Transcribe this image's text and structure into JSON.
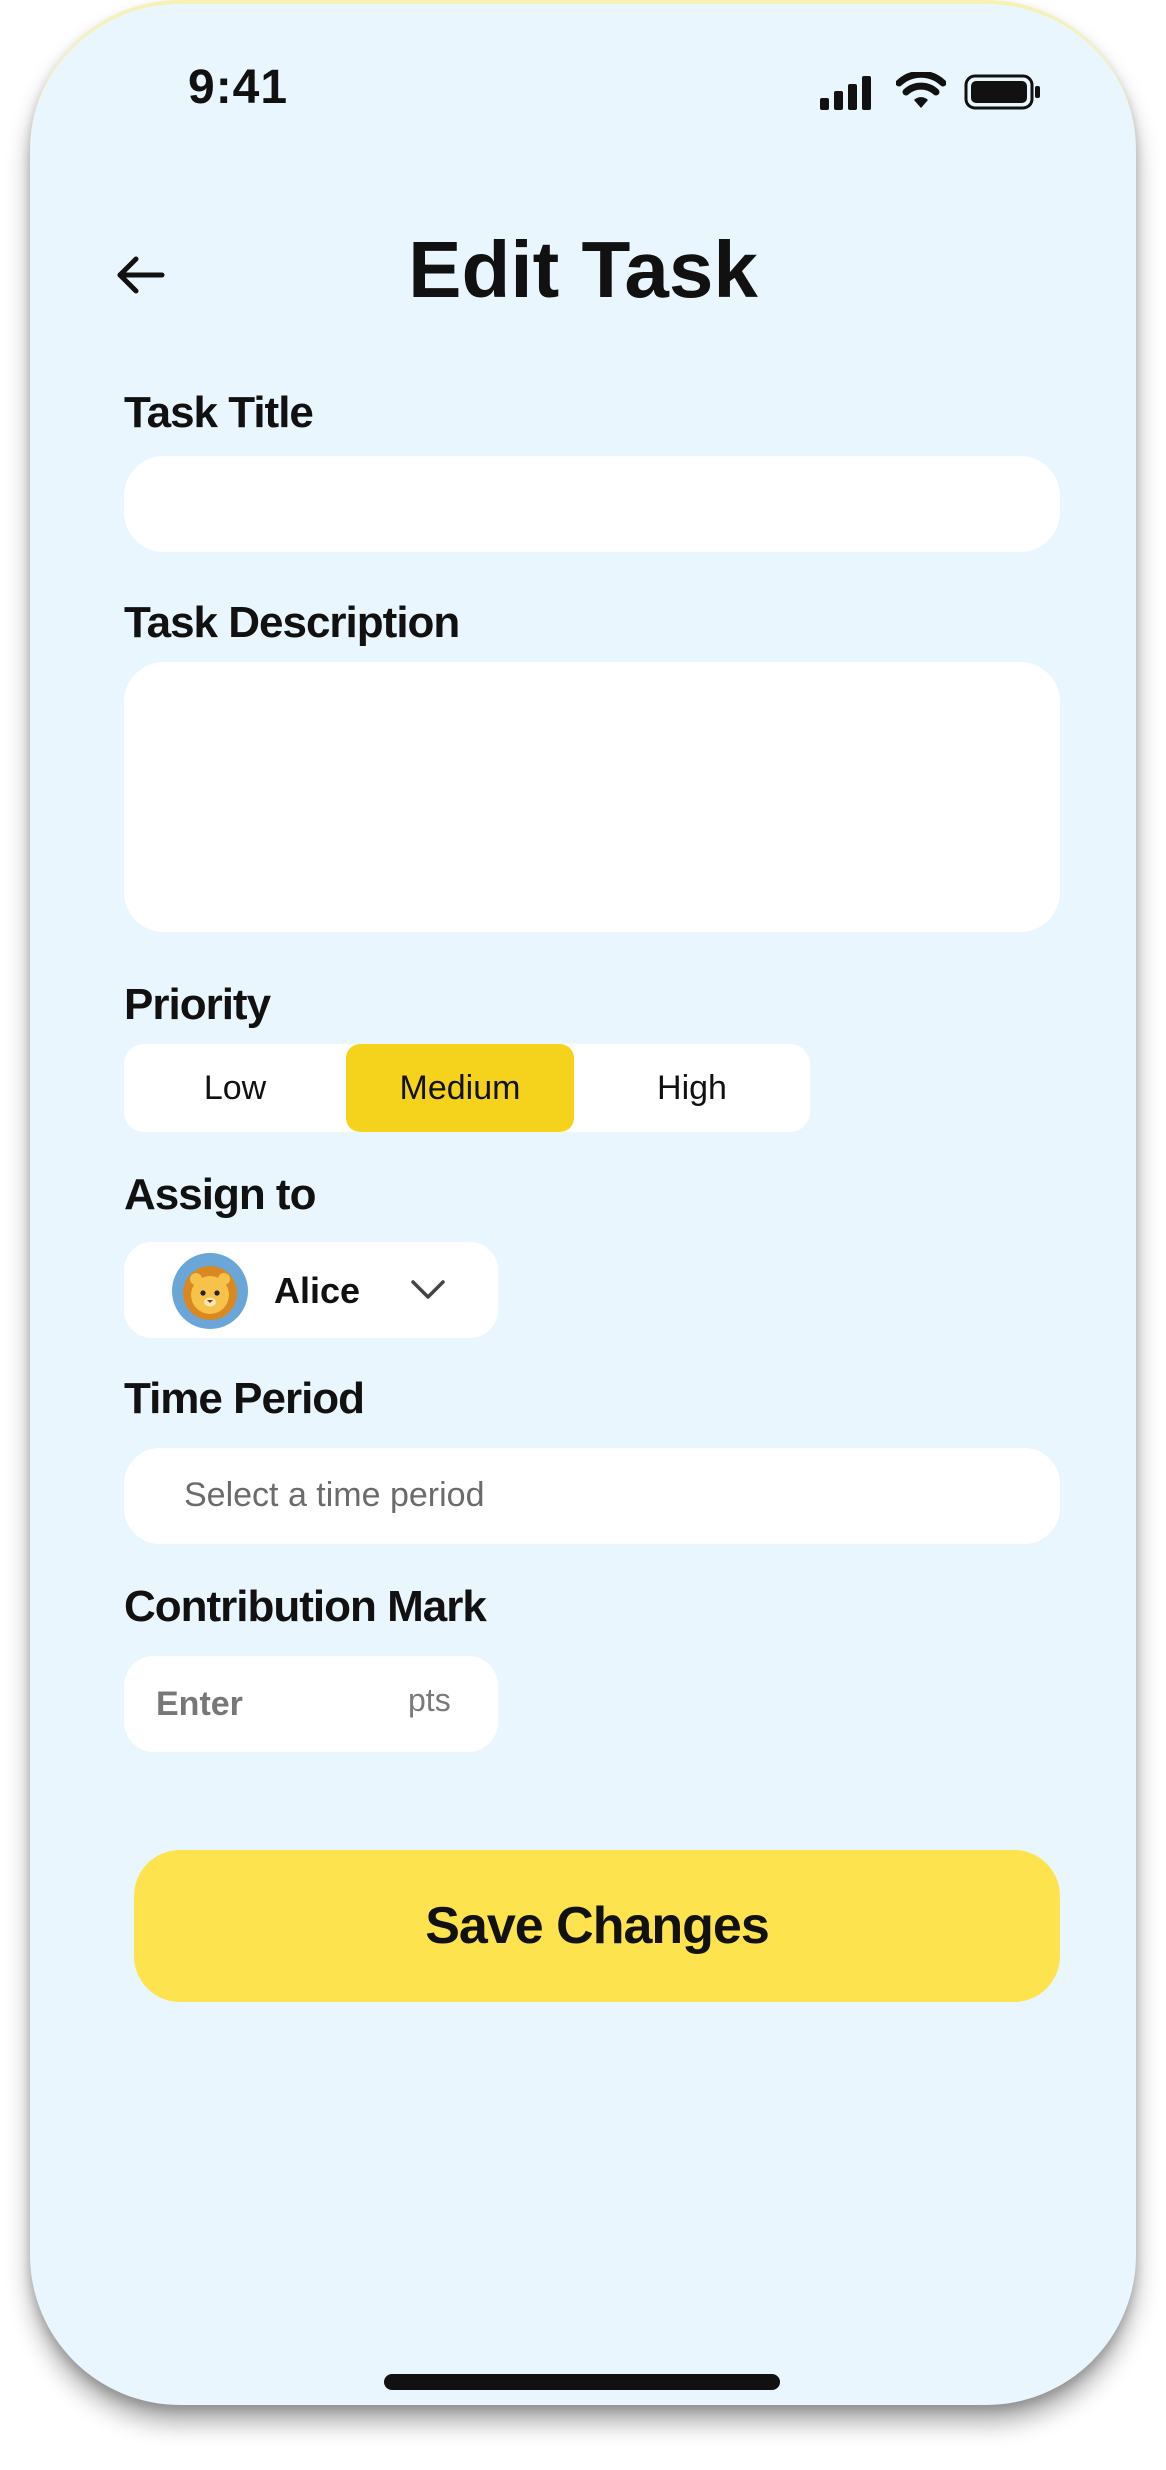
{
  "status_bar": {
    "time": "9:41",
    "icons": [
      "cellular-signal-icon",
      "wifi-icon",
      "battery-icon"
    ]
  },
  "header": {
    "title": "Edit Task",
    "back_icon": "arrow-left-icon"
  },
  "form": {
    "task_title": {
      "label": "Task Title",
      "value": "",
      "placeholder": ""
    },
    "task_description": {
      "label": "Task Description",
      "value": "",
      "placeholder": ""
    },
    "priority": {
      "label": "Priority",
      "options": [
        "Low",
        "Medium",
        "High"
      ],
      "selected": "Medium"
    },
    "assign_to": {
      "label": "Assign to",
      "selected_name": "Alice",
      "avatar": "lion-avatar",
      "dropdown_icon": "chevron-down-icon"
    },
    "time_period": {
      "label": "Time Period",
      "placeholder": "Select a time period"
    },
    "contribution_mark": {
      "label": "Contribution Mark",
      "placeholder": "Enter",
      "unit": "pts"
    }
  },
  "actions": {
    "save_label": "Save Changes"
  },
  "colors": {
    "background": "#eaf6fd",
    "accent_selected": "#f5d31d",
    "primary_button": "#fde34e",
    "surface": "#ffffff"
  }
}
